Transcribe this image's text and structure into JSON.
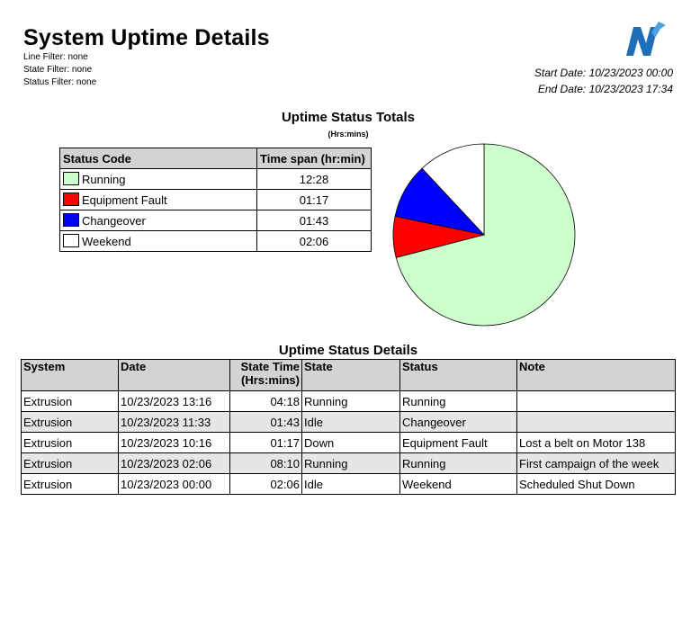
{
  "header": {
    "title": "System Uptime Details",
    "filters": [
      "Line Filter: none",
      "State Filter: none",
      "Status Filter: none"
    ],
    "start_date": "Start Date: 10/23/2023 00:00",
    "end_date": "End Date: 10/23/2023 17:34"
  },
  "colors": {
    "running": "#ccffcc",
    "equipment_fault": "#ff0000",
    "changeover": "#0000ff",
    "weekend": "#ffffff",
    "header_bg": "#d3d3d3",
    "logo_blue": "#1f6fb8"
  },
  "totals": {
    "title": "Uptime Status Totals",
    "subtitle": "(Hrs:mins)",
    "headers": [
      "Status Code",
      "Time span (hr:min)"
    ],
    "rows": [
      {
        "label": "Running",
        "value": "12:28",
        "color": "#ccffcc"
      },
      {
        "label": "Equipment Fault",
        "value": "01:17",
        "color": "#ff0000"
      },
      {
        "label": "Changeover",
        "value": "01:43",
        "color": "#0000ff"
      },
      {
        "label": "Weekend",
        "value": "02:06",
        "color": "#ffffff"
      }
    ]
  },
  "chart_data": {
    "type": "pie",
    "categories": [
      "Running",
      "Equipment Fault",
      "Changeover",
      "Weekend"
    ],
    "values": [
      748,
      77,
      103,
      126
    ],
    "colors": [
      "#ccffcc",
      "#ff0000",
      "#0000ff",
      "#ffffff"
    ]
  },
  "details": {
    "title": "Uptime Status Details",
    "headers": [
      "System",
      "Date",
      "State Time",
      "(Hrs:mins)",
      "State",
      "Status",
      "Note"
    ],
    "rows": [
      [
        "Extrusion",
        "10/23/2023 13:16",
        "04:18",
        "Running",
        "Running",
        ""
      ],
      [
        "Extrusion",
        "10/23/2023 11:33",
        "01:43",
        "Idle",
        "Changeover",
        ""
      ],
      [
        "Extrusion",
        "10/23/2023 10:16",
        "01:17",
        "Down",
        "Equipment Fault",
        "Lost a belt on Motor 138"
      ],
      [
        "Extrusion",
        "10/23/2023 02:06",
        "08:10",
        "Running",
        "Running",
        "First campaign of the week"
      ],
      [
        "Extrusion",
        "10/23/2023 00:00",
        "02:06",
        "Idle",
        "Weekend",
        "Scheduled Shut Down"
      ]
    ]
  }
}
